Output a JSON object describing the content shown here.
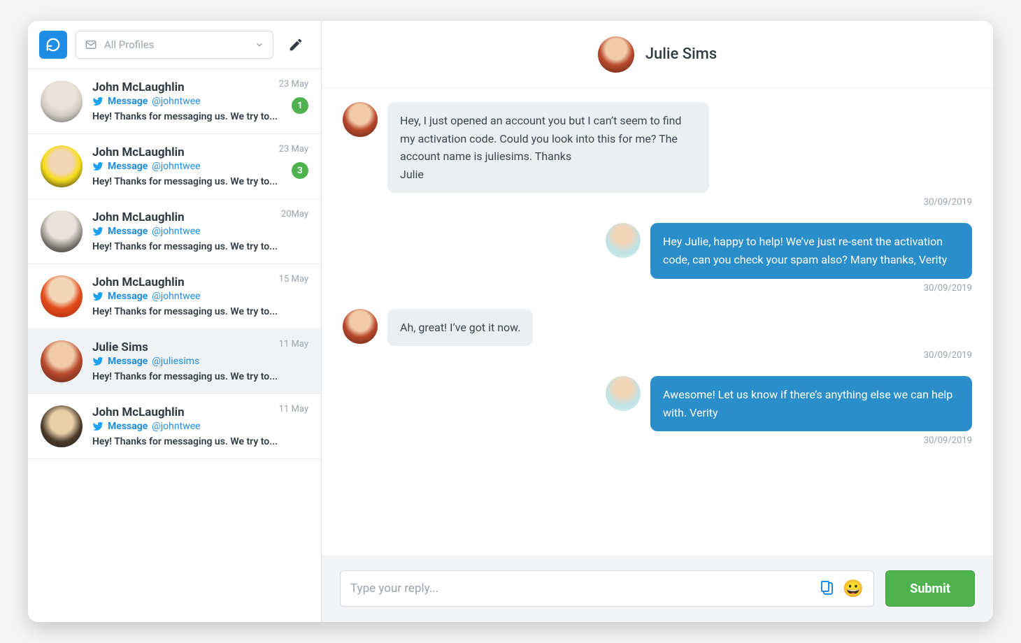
{
  "toolbar": {
    "profile_selector_label": "All Profiles"
  },
  "conversations": [
    {
      "name": "John McLaughlin",
      "source_label": "Message",
      "handle": "@johntwee",
      "snippet": "Hey! Thanks for messaging us. We try to...",
      "date": "23 May",
      "badge": "1",
      "avatar": "avatar-1"
    },
    {
      "name": "John McLaughlin",
      "source_label": "Message",
      "handle": "@johntwee",
      "snippet": "Hey! Thanks for messaging us. We try to...",
      "date": "23 May",
      "badge": "3",
      "avatar": "avatar-2"
    },
    {
      "name": "John McLaughlin",
      "source_label": "Message",
      "handle": "@johntwee",
      "snippet": "Hey! Thanks for messaging us. We try to...",
      "date": "20May",
      "badge": "",
      "avatar": "avatar-3"
    },
    {
      "name": "John McLaughlin",
      "source_label": "Message",
      "handle": "@johntwee",
      "snippet": "Hey! Thanks for messaging us. We try to...",
      "date": "15 May",
      "badge": "",
      "avatar": "avatar-4"
    },
    {
      "name": "Julie Sims",
      "source_label": "Message",
      "handle": "@juliesims",
      "snippet": "Hey! Thanks for messaging us. We try to...",
      "date": "11 May",
      "badge": "",
      "avatar": "avatar-5",
      "selected": true
    },
    {
      "name": "John McLaughlin",
      "source_label": "Message",
      "handle": "@johntwee",
      "snippet": "Hey! Thanks for messaging us. We try to...",
      "date": "11 May",
      "badge": "",
      "avatar": "avatar-6"
    }
  ],
  "chat": {
    "title": "Julie Sims",
    "messages": [
      {
        "side": "left",
        "text": "Hey, I just opened an account you but I can’t seem to find my activation code. Could you look into this for me? The account name is juliesims. Thanks\nJulie",
        "time": "30/09/2019",
        "avatar": "avatar-5"
      },
      {
        "side": "right",
        "text": "Hey Julie, happy to help! We’ve just re-sent the activation code, can you check your spam also? Many thanks, Verity",
        "time": "30/09/2019",
        "avatar": "avatar-agent"
      },
      {
        "side": "left",
        "text": "Ah, great! I’ve got it now.",
        "time": "30/09/2019",
        "avatar": "avatar-5"
      },
      {
        "side": "right",
        "text": "Awesome! Let us know if there’s anything else we can help with. Verity",
        "time": "30/09/2019",
        "avatar": "avatar-agent"
      }
    ],
    "placeholder": "Type your reply...",
    "submit_label": "Submit"
  }
}
